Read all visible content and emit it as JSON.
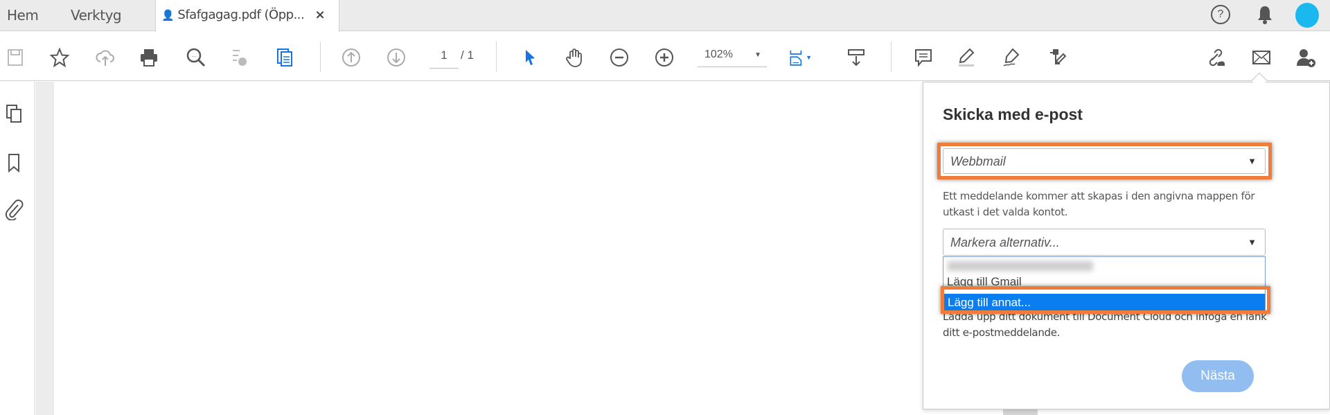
{
  "tabs": {
    "home": "Hem",
    "tools": "Verktyg",
    "document": "Sfafgagag.pdf (Öpp...",
    "close": "×"
  },
  "toolbar": {
    "page_current": "1",
    "page_total": "/ 1",
    "zoom": "102%"
  },
  "panel": {
    "title": "Skicka med e-post",
    "provider_select": "Webbmail",
    "description": "Ett meddelande kommer att skapas i den angivna mappen för utkast i det valda kontot.",
    "account_select_placeholder": "Markera alternativ...",
    "options": [
      "Lägg till Gmail",
      "Lägg till annat..."
    ],
    "upload_text_hidden": "Ladda upp ditt dokument till Document Cloud och infoga en länk i",
    "upload_text": "ditt e-postmeddelande.",
    "next_button": "Nästa"
  },
  "colors": {
    "accent": "#1473e6",
    "highlight": "#f07c3a",
    "selected": "#0a7ef0",
    "next_button": "#92bdf0"
  }
}
